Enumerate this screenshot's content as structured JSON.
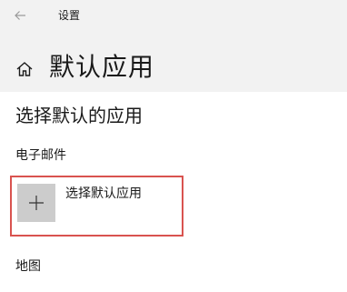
{
  "window": {
    "title": "设置",
    "back_icon": "back-arrow-icon"
  },
  "header": {
    "home_icon": "home-icon",
    "title": "默认应用"
  },
  "main": {
    "section_heading": "选择默认的应用",
    "categories": [
      {
        "label": "电子邮件",
        "picker_icon": "plus-icon",
        "picker_label": "选择默认应用",
        "highlighted": true,
        "highlight_color": "#d9534f"
      },
      {
        "label": "地图"
      }
    ]
  },
  "colors": {
    "header_background": "#f2f2f2",
    "page_background": "#ffffff",
    "tile_background": "#cccccc",
    "highlight_border": "#d9534f"
  }
}
